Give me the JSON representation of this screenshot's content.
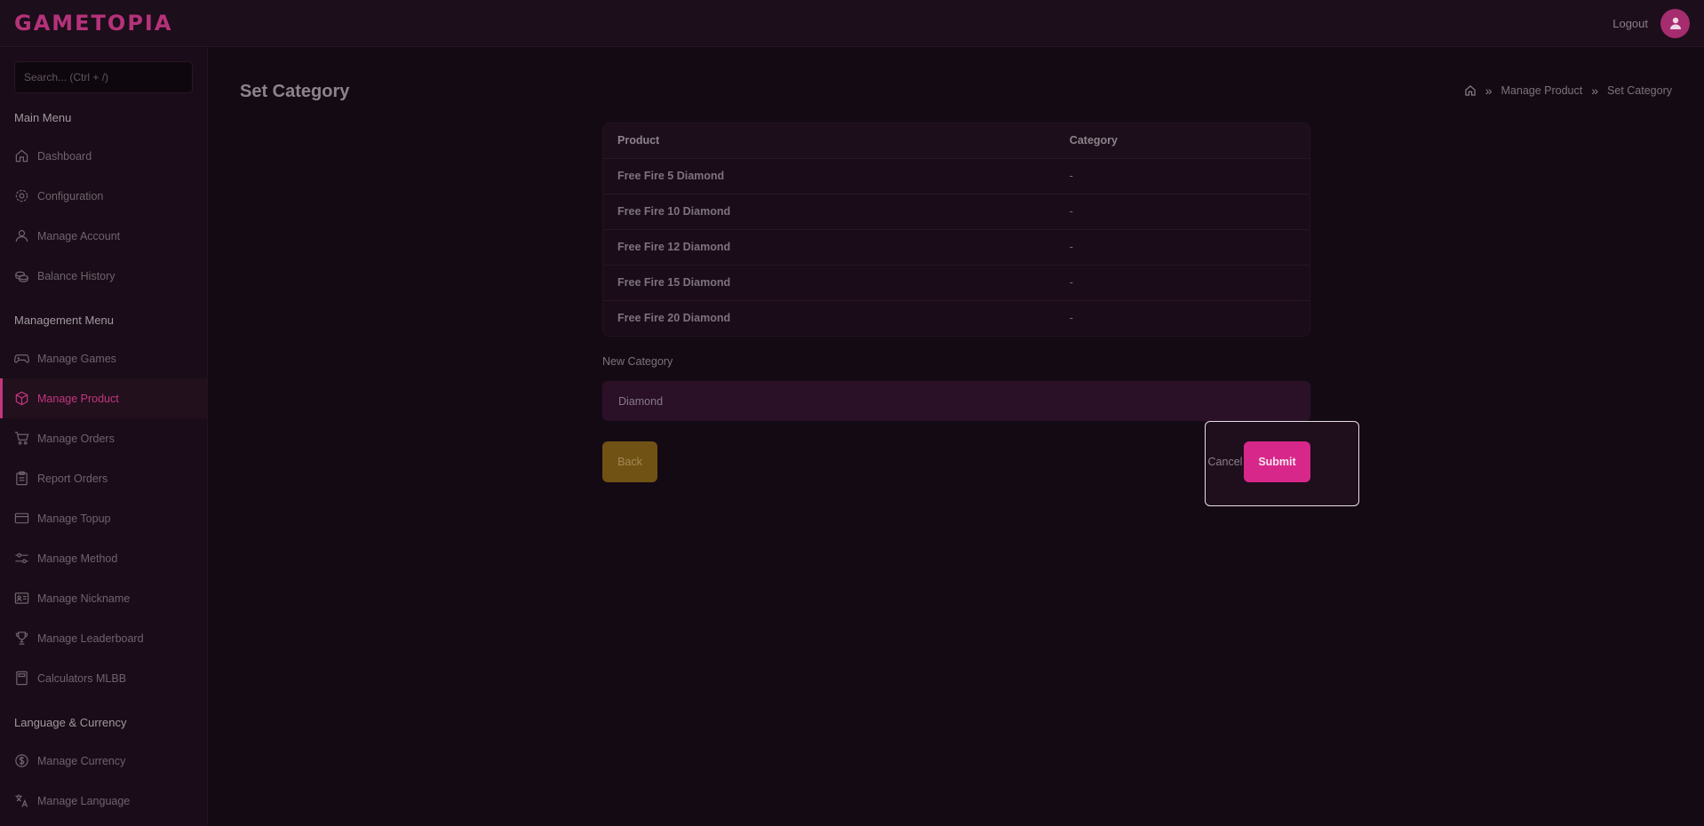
{
  "app": {
    "logo": "GAMETOPIA",
    "logout": "Logout"
  },
  "search": {
    "placeholder": "Search... (Ctrl + /)"
  },
  "sidebar": {
    "sections": [
      {
        "title": "Main Menu"
      },
      {
        "title": "Management Menu"
      },
      {
        "title": "Language & Currency"
      }
    ],
    "items": [
      {
        "label": "Dashboard",
        "icon": "home-icon"
      },
      {
        "label": "Configuration",
        "icon": "gear-icon"
      },
      {
        "label": "Manage Account",
        "icon": "user-icon"
      },
      {
        "label": "Balance History",
        "icon": "coins-icon"
      },
      {
        "label": "Manage Games",
        "icon": "gamepad-icon"
      },
      {
        "label": "Manage Product",
        "icon": "box-icon",
        "active": true
      },
      {
        "label": "Manage Orders",
        "icon": "cart-icon"
      },
      {
        "label": "Report Orders",
        "icon": "clipboard-icon"
      },
      {
        "label": "Manage Topup",
        "icon": "card-icon"
      },
      {
        "label": "Manage Method",
        "icon": "sliders-icon"
      },
      {
        "label": "Manage Nickname",
        "icon": "id-card-icon"
      },
      {
        "label": "Manage Leaderboard",
        "icon": "trophy-icon"
      },
      {
        "label": "Calculators MLBB",
        "icon": "calculator-icon"
      },
      {
        "label": "Manage Currency",
        "icon": "dollar-icon"
      },
      {
        "label": "Manage Language",
        "icon": "translate-icon"
      }
    ]
  },
  "page": {
    "title": "Set Category",
    "breadcrumb": [
      "Manage Product",
      "Set Category"
    ]
  },
  "table": {
    "headers": [
      "Product",
      "Category"
    ],
    "rows": [
      [
        "Free Fire 5 Diamond",
        "-"
      ],
      [
        "Free Fire 10 Diamond",
        "-"
      ],
      [
        "Free Fire 12 Diamond",
        "-"
      ],
      [
        "Free Fire 15 Diamond",
        "-"
      ],
      [
        "Free Fire 20 Diamond",
        "-"
      ]
    ]
  },
  "form": {
    "label": "New Category",
    "value": "Diamond",
    "back": "Back",
    "cancel": "Cancel",
    "submit": "Submit"
  },
  "colors": {
    "accent": "#d8278a",
    "background": "#140a14",
    "back_button": "#705214"
  }
}
